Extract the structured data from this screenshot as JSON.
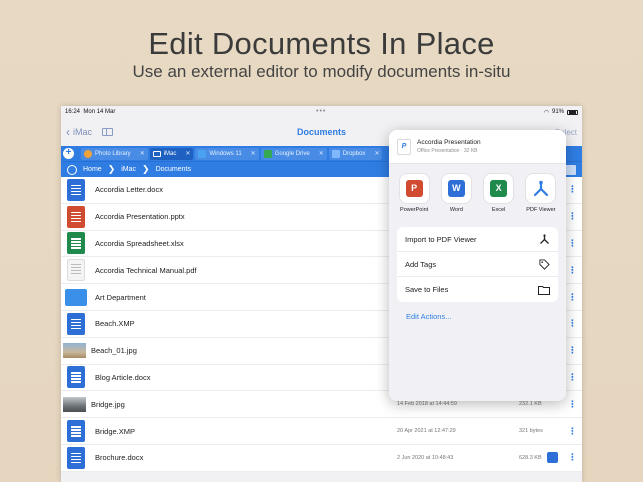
{
  "promo": {
    "title": "Edit Documents In Place",
    "subtitle": "Use an external editor to modify documents in-situ"
  },
  "status": {
    "time": "16:24",
    "date": "Mon 14 Mar",
    "battery": "91%"
  },
  "nav": {
    "back_label": "iMac",
    "title": "Documents",
    "select_label": "Select"
  },
  "tabs": [
    {
      "label": "Photo Library",
      "icon": "photos-icon",
      "color": "#f2a23a"
    },
    {
      "label": "iMac",
      "icon": "monitor-icon",
      "color": "#ffffff",
      "active": true
    },
    {
      "label": "Windows 11",
      "icon": "windows-icon",
      "color": "#4aa3f0"
    },
    {
      "label": "Google Drive",
      "icon": "google-drive-icon",
      "color": "#34a853"
    },
    {
      "label": "Dropbox",
      "icon": "dropbox-icon",
      "color": "#7fb8ff"
    }
  ],
  "path": {
    "home": "Home",
    "folder": "iMac",
    "current": "Documents"
  },
  "files": [
    {
      "name": "Accordia Letter.docx",
      "type": "doc",
      "date": "",
      "size": ""
    },
    {
      "name": "Accordia Presentation.pptx",
      "type": "ppt",
      "date": "",
      "size": ""
    },
    {
      "name": "Accordia Spreadsheet.xlsx",
      "type": "xls",
      "date": "",
      "size": ""
    },
    {
      "name": "Accordia Technical Manual.pdf",
      "type": "pdf",
      "date": "",
      "size": ""
    },
    {
      "name": "Art Department",
      "type": "folder",
      "date": "",
      "size": ""
    },
    {
      "name": "Beach.XMP",
      "type": "doc",
      "date": "",
      "size": ""
    },
    {
      "name": "Beach_01.jpg",
      "type": "img",
      "date": "",
      "size": ""
    },
    {
      "name": "Blog Article.docx",
      "type": "doc",
      "date": "",
      "size": ""
    },
    {
      "name": "Bridge.jpg",
      "type": "img2",
      "date": "14 Feb 2018 at 14:44:59",
      "size": "232.1 KB"
    },
    {
      "name": "Bridge.XMP",
      "type": "doc",
      "date": "20 Apr 2021 at 12:47:29",
      "size": "321 bytes"
    },
    {
      "name": "Brochure.docx",
      "type": "doc",
      "date": "2 Jun 2020 at 10:48:43",
      "size": "628.3 KB"
    }
  ],
  "share_sheet": {
    "title": "Accordia Presentation",
    "subtitle": "Office Presentation · 32 KB",
    "apps": [
      {
        "label": "PowerPoint",
        "glyph": "P",
        "color": "#d04b2f"
      },
      {
        "label": "Word",
        "glyph": "W",
        "color": "#2d6fd6"
      },
      {
        "label": "Excel",
        "glyph": "X",
        "color": "#1f8a4c"
      },
      {
        "label": "PDF Viewer",
        "glyph": "",
        "color": "#2f7de3"
      }
    ],
    "actions": [
      {
        "label": "Import to PDF Viewer",
        "icon": "pdf-viewer-icon"
      },
      {
        "label": "Add Tags",
        "icon": "tag-icon"
      },
      {
        "label": "Save to Files",
        "icon": "folder-icon"
      }
    ],
    "edit_actions": "Edit Actions..."
  }
}
